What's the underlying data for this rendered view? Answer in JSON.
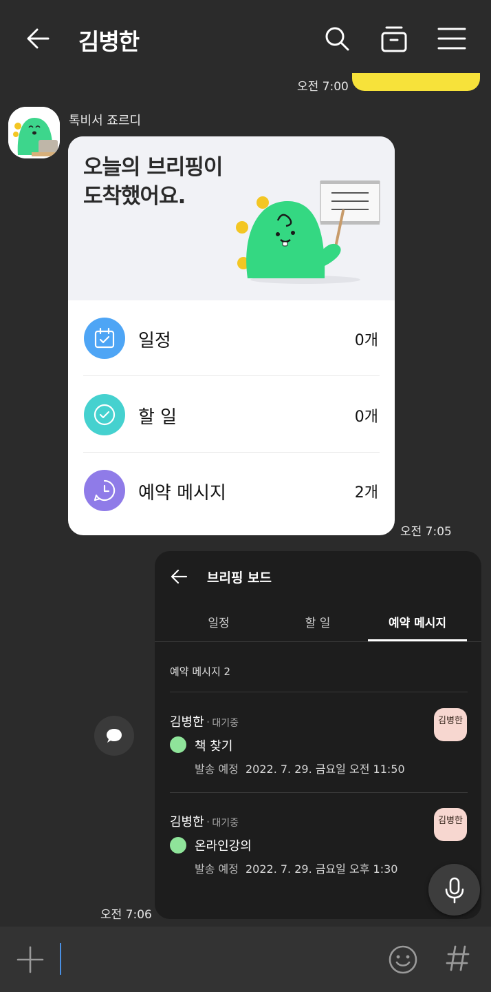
{
  "header": {
    "title": "김병한",
    "back_icon": "arrow-left-icon",
    "search_icon": "search-icon",
    "drawer_icon": "drawer-icon",
    "menu_icon": "hamburger-menu-icon"
  },
  "messages": {
    "prev_time": "오전 7:00",
    "sender_name": "톡비서 죠르디",
    "briefing_time": "오전 7:05",
    "board_time": "오전 7:06"
  },
  "briefing_card": {
    "headline_line1": "오늘의 브리핑이",
    "headline_line2": "도착했어요.",
    "rows": [
      {
        "label": "일정",
        "count": "0개",
        "icon": "calendar-check-icon",
        "color": "#4ea5f5"
      },
      {
        "label": "할 일",
        "count": "0개",
        "icon": "check-circle-icon",
        "color": "#45d1cf"
      },
      {
        "label": "예약 메시지",
        "count": "2개",
        "icon": "clock-icon",
        "color": "#8f7be8"
      }
    ]
  },
  "board": {
    "title": "브리핑 보드",
    "tabs": [
      {
        "label": "일정",
        "active": false
      },
      {
        "label": "할 일",
        "active": false
      },
      {
        "label": "예약 메시지",
        "active": true
      }
    ],
    "section_label": "예약 메시지 2",
    "items": [
      {
        "name": "김병한",
        "status": "대기중",
        "subject": "책 찾기",
        "sched_label": "발송 예정",
        "sched_value": "2022. 7. 29. 금요일 오전 11:50",
        "thumb_text": "김병한"
      },
      {
        "name": "김병한",
        "status": "대기중",
        "subject": "온라인강의",
        "sched_label": "발송 예정",
        "sched_value": "2022. 7. 29. 금요일 오후 1:30",
        "thumb_text": "김병한"
      }
    ]
  },
  "input_bar": {
    "plus_icon": "plus-icon",
    "emoji_icon": "smiley-icon",
    "hashtag_icon": "hashtag-icon",
    "mic_icon": "microphone-icon"
  }
}
